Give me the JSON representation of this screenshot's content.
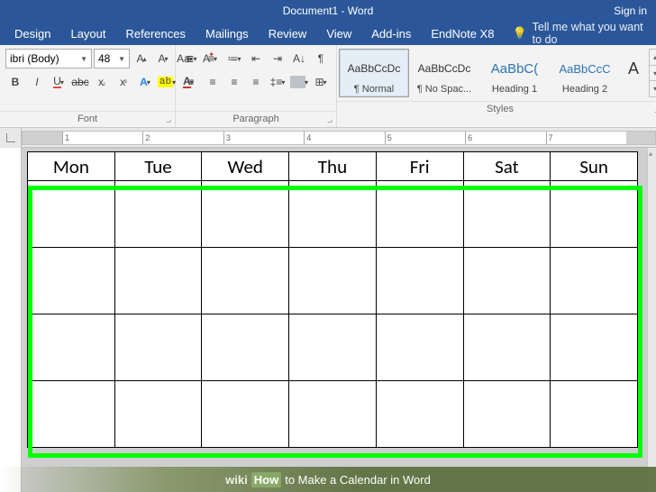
{
  "title": "Document1  -  Word",
  "signin": "Sign in",
  "tabs": [
    "Design",
    "Layout",
    "References",
    "Mailings",
    "Review",
    "View",
    "Add-ins",
    "EndNote X8"
  ],
  "tell_me": "Tell me what you want to do",
  "font": {
    "name": "ibri (Body)",
    "size": "48",
    "group_label": "Font"
  },
  "paragraph": {
    "group_label": "Paragraph"
  },
  "styles": {
    "group_label": "Styles",
    "items": [
      {
        "preview": "AaBbCcDc",
        "name": "¶ Normal",
        "cls": "para",
        "selected": true
      },
      {
        "preview": "AaBbCcDc",
        "name": "¶ No Spac...",
        "cls": "para"
      },
      {
        "preview": "AaBbC(",
        "name": "Heading 1",
        "cls": "h1"
      },
      {
        "preview": "AaBbCcC",
        "name": "Heading 2",
        "cls": "h2"
      },
      {
        "preview": "A",
        "name": "",
        "cls": "big"
      }
    ]
  },
  "ruler": [
    "1",
    "2",
    "3",
    "4",
    "5",
    "6",
    "7"
  ],
  "calendar": {
    "days": [
      "Mon",
      "Tue",
      "Wed",
      "Thu",
      "Fri",
      "Sat",
      "Sun"
    ],
    "rows": 4
  },
  "banner": {
    "wiki": "wiki",
    "how": "How",
    "text": " to Make a Calendar in Word"
  }
}
